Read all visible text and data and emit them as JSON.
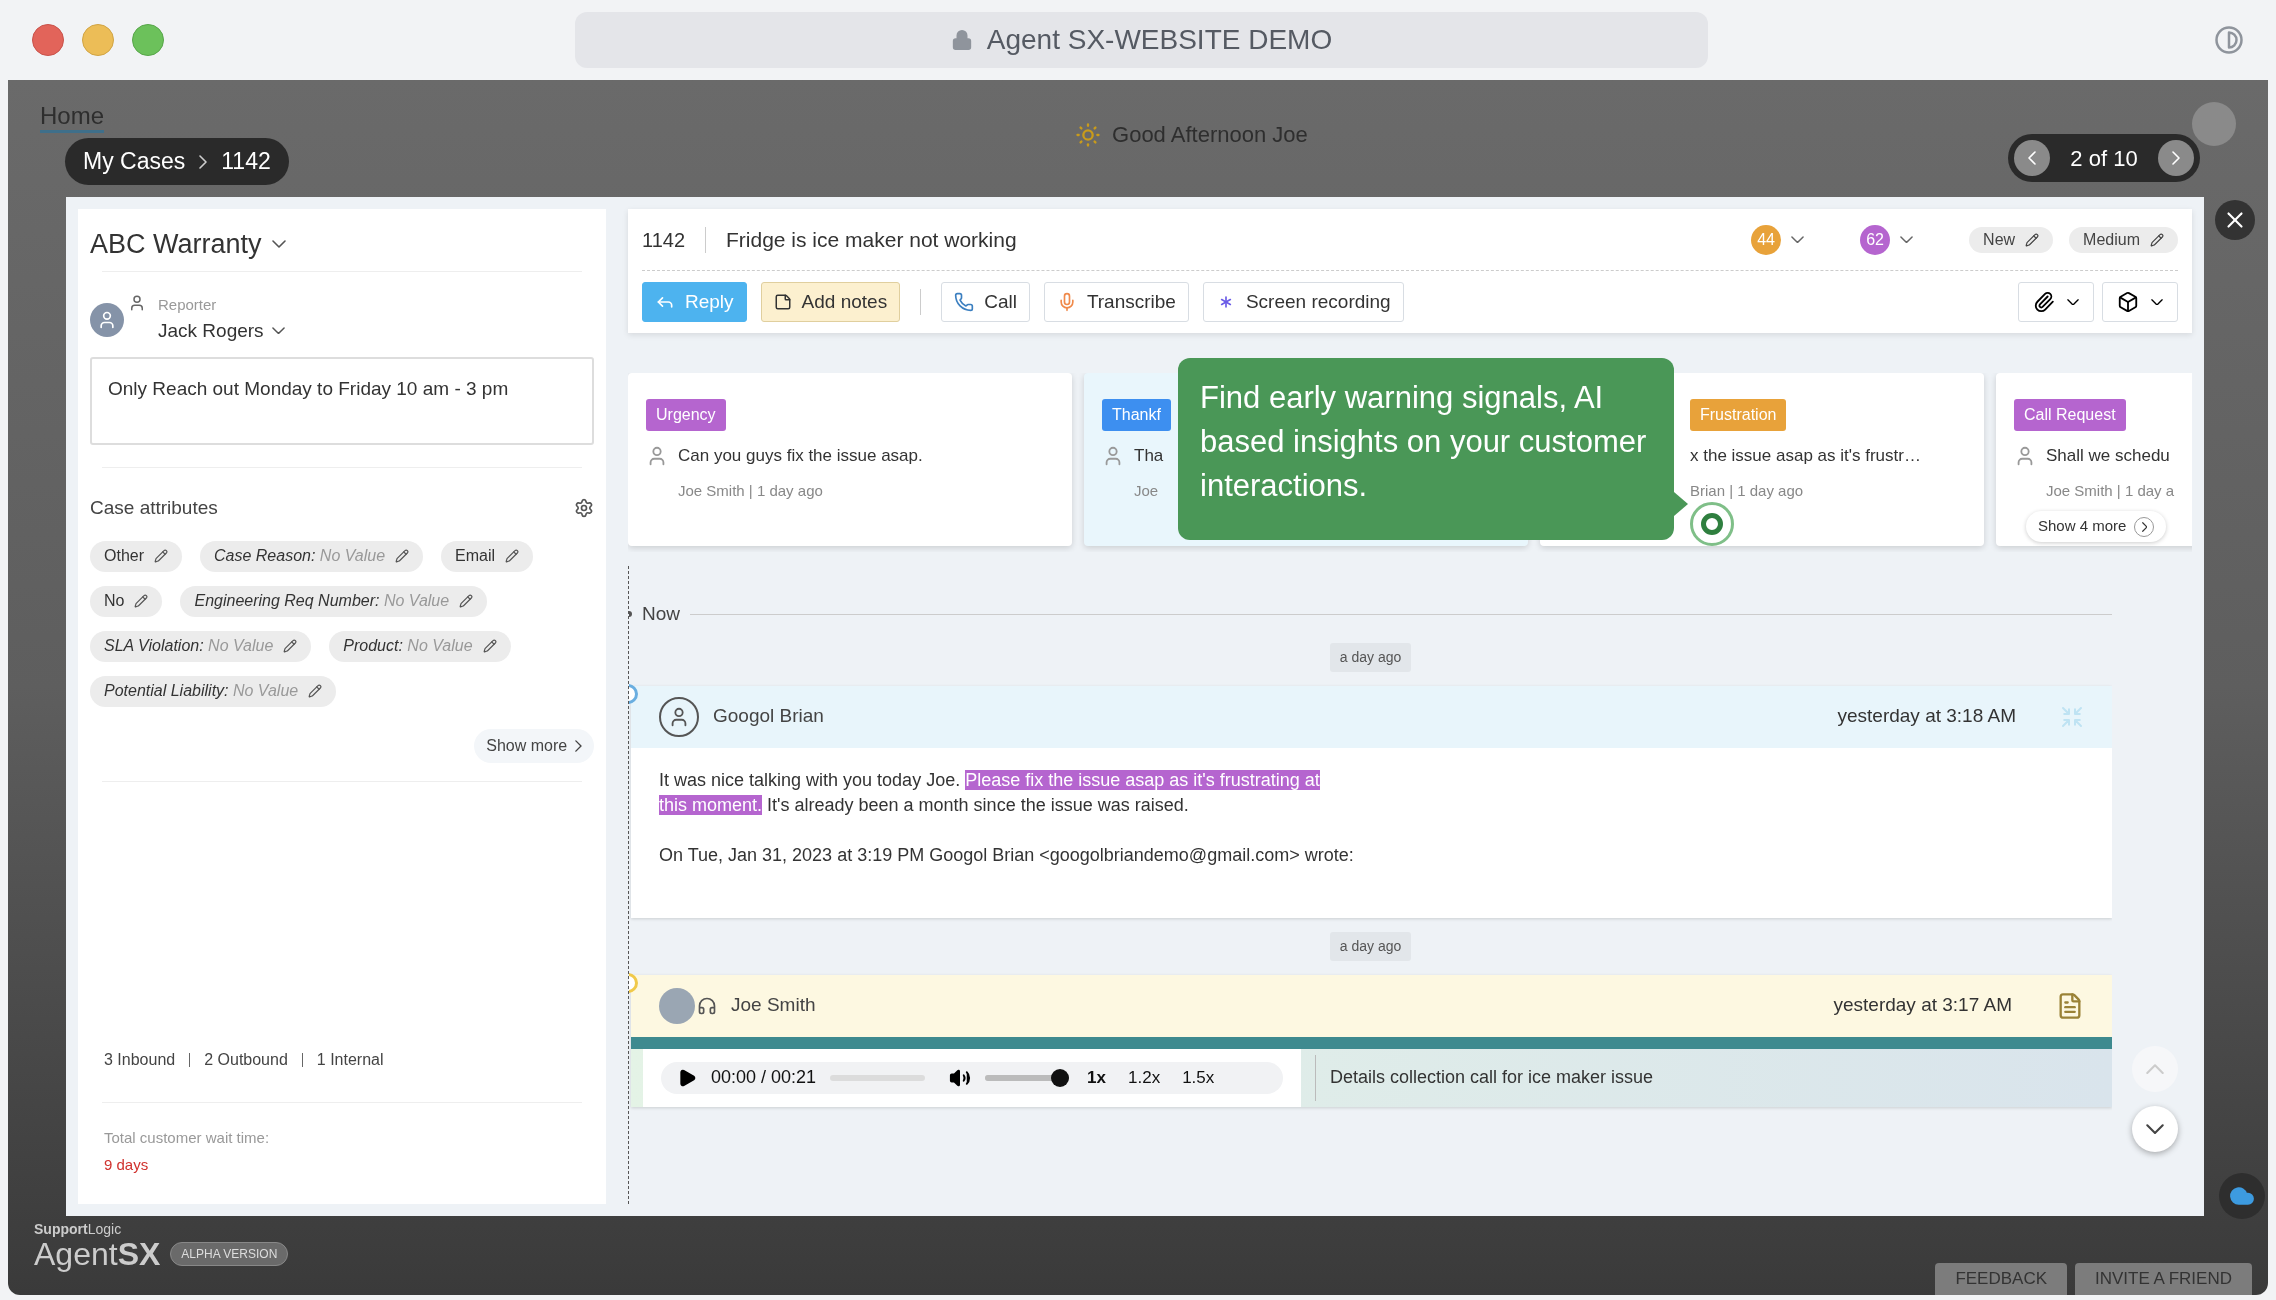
{
  "browser": {
    "title": "Agent SX-WEBSITE DEMO"
  },
  "backdrop": {
    "home_tab": "Home",
    "greeting": "Good Afternoon Joe"
  },
  "breadcrumb": [
    "My Cases",
    "1142"
  ],
  "pager": {
    "label": "2 of 10"
  },
  "case_panel": {
    "account": "ABC Warranty",
    "reporter_label": "Reporter",
    "reporter": "Jack Rogers",
    "note": "Only Reach out Monday to Friday 10 am - 3 pm",
    "attributes_title": "Case attributes",
    "attributes": [
      {
        "label": "Other"
      },
      {
        "label": "Case Reason:",
        "value": "No Value"
      },
      {
        "label": "Email"
      },
      {
        "label": "No"
      },
      {
        "label": "Engineering Req Number:",
        "value": "No Value"
      },
      {
        "label": "SLA Violation:",
        "value": "No Value"
      },
      {
        "label": "Product:",
        "value": "No Value"
      },
      {
        "label": "Potential Liability:",
        "value": "No Value"
      }
    ],
    "show_more": "Show more",
    "counts": [
      "3 Inbound",
      "2 Outbound",
      "1 Internal"
    ],
    "wait_label": "Total customer wait time:",
    "wait_value": "9 days"
  },
  "case_header": {
    "number": "1142",
    "title": "Fridge is ice maker not working",
    "scores": [
      {
        "value": "44",
        "color": "#e8a23a"
      },
      {
        "value": "62",
        "color": "#b565cf"
      }
    ],
    "status": "New",
    "priority": "Medium",
    "actions": [
      {
        "kind": "reply",
        "label": "Reply"
      },
      {
        "kind": "notes",
        "label": "Add notes"
      },
      {
        "kind": "call",
        "label": "Call"
      },
      {
        "kind": "transcribe",
        "label": "Transcribe"
      },
      {
        "kind": "record",
        "label": "Screen recording"
      }
    ]
  },
  "signals": [
    {
      "tag": "Urgency",
      "color": "#b565cf",
      "text": "Can you guys fix the issue asap.",
      "meta": "Joe Smith | 1 day ago",
      "selected": false,
      "covered": false
    },
    {
      "tag": "Thankf",
      "color": "#3d8ff0",
      "text": "Tha",
      "meta": "Joe",
      "selected": true,
      "covered": false
    },
    {
      "tag": "Frustration",
      "color": "#e8a23a",
      "text": "x the issue asap as it's frustr…",
      "meta": "Brian | 1 day ago",
      "selected": false,
      "covered": true
    },
    {
      "tag": "Call Request",
      "color": "#b565cf",
      "text": "Shall we schedu",
      "meta": "Joe Smith | 1 day a",
      "selected": false,
      "covered": false
    }
  ],
  "show_more_signals": "Show 4 more",
  "tooltip": "Find early warning signals, AI based insights on your customer interactions.",
  "timeline": {
    "now": "Now",
    "entries": [
      {
        "kind": "email",
        "time_chip": "a day ago",
        "author": "Googol Brian",
        "time": "yesterday at 3:18 AM",
        "text_before": "It was nice talking with you today Joe.",
        "highlight": "Please fix the issue asap as it's frustrating at this moment.",
        "text_after": "It's already been a month since the issue was raised.",
        "quote": "On Tue, Jan 31, 2023 at 3:19 PM Googol Brian <googolbriandemo@gmail.com> wrote:"
      },
      {
        "kind": "call",
        "time_chip": "a day ago",
        "author": "Joe Smith",
        "time": "yesterday at 3:17 AM",
        "player": {
          "time": "00:00 / 00:21",
          "progress": {
            "level": 0
          },
          "volume": {
            "level": 1
          },
          "speeds": [
            {
              "label": "1x",
              "selected": true
            },
            {
              "label": "1.2x",
              "selected": false
            },
            {
              "label": "1.5x",
              "selected": false
            }
          ]
        },
        "summary": "Details collection call for ice maker issue"
      }
    ]
  },
  "footer": {
    "brand_small": "**Support**Logic",
    "brand": "Agent**SX**",
    "badge": "ALPHA VERSION",
    "buttons": [
      "FEEDBACK",
      "INVITE A FRIEND"
    ]
  }
}
